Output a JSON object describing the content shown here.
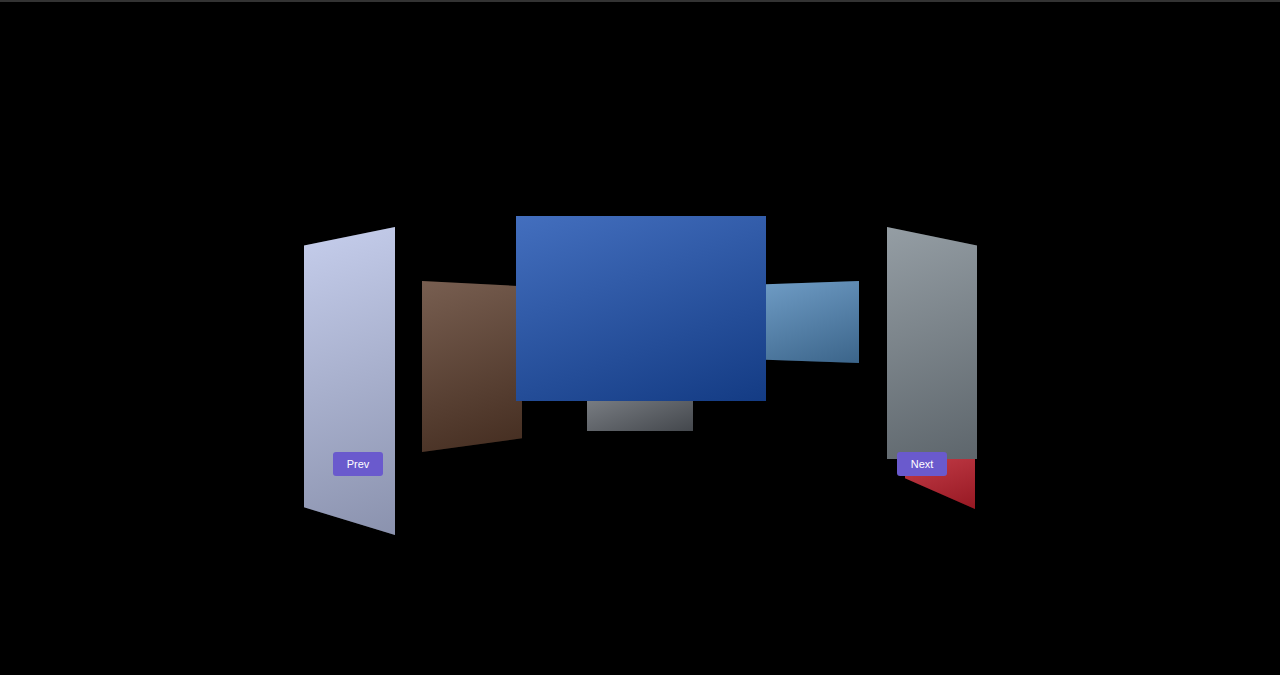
{
  "carousel": {
    "cards": [
      {
        "color": "#c8202e"
      },
      {
        "color": "#5a5f66"
      },
      {
        "color": "#b9c3e8"
      },
      {
        "color": "#5a3b2a"
      },
      {
        "color": "#4f86b8"
      },
      {
        "color": "#7d8890"
      },
      {
        "color": "#1a4fb0"
      }
    ]
  },
  "buttons": {
    "prev": "Prev",
    "next": "Next"
  }
}
